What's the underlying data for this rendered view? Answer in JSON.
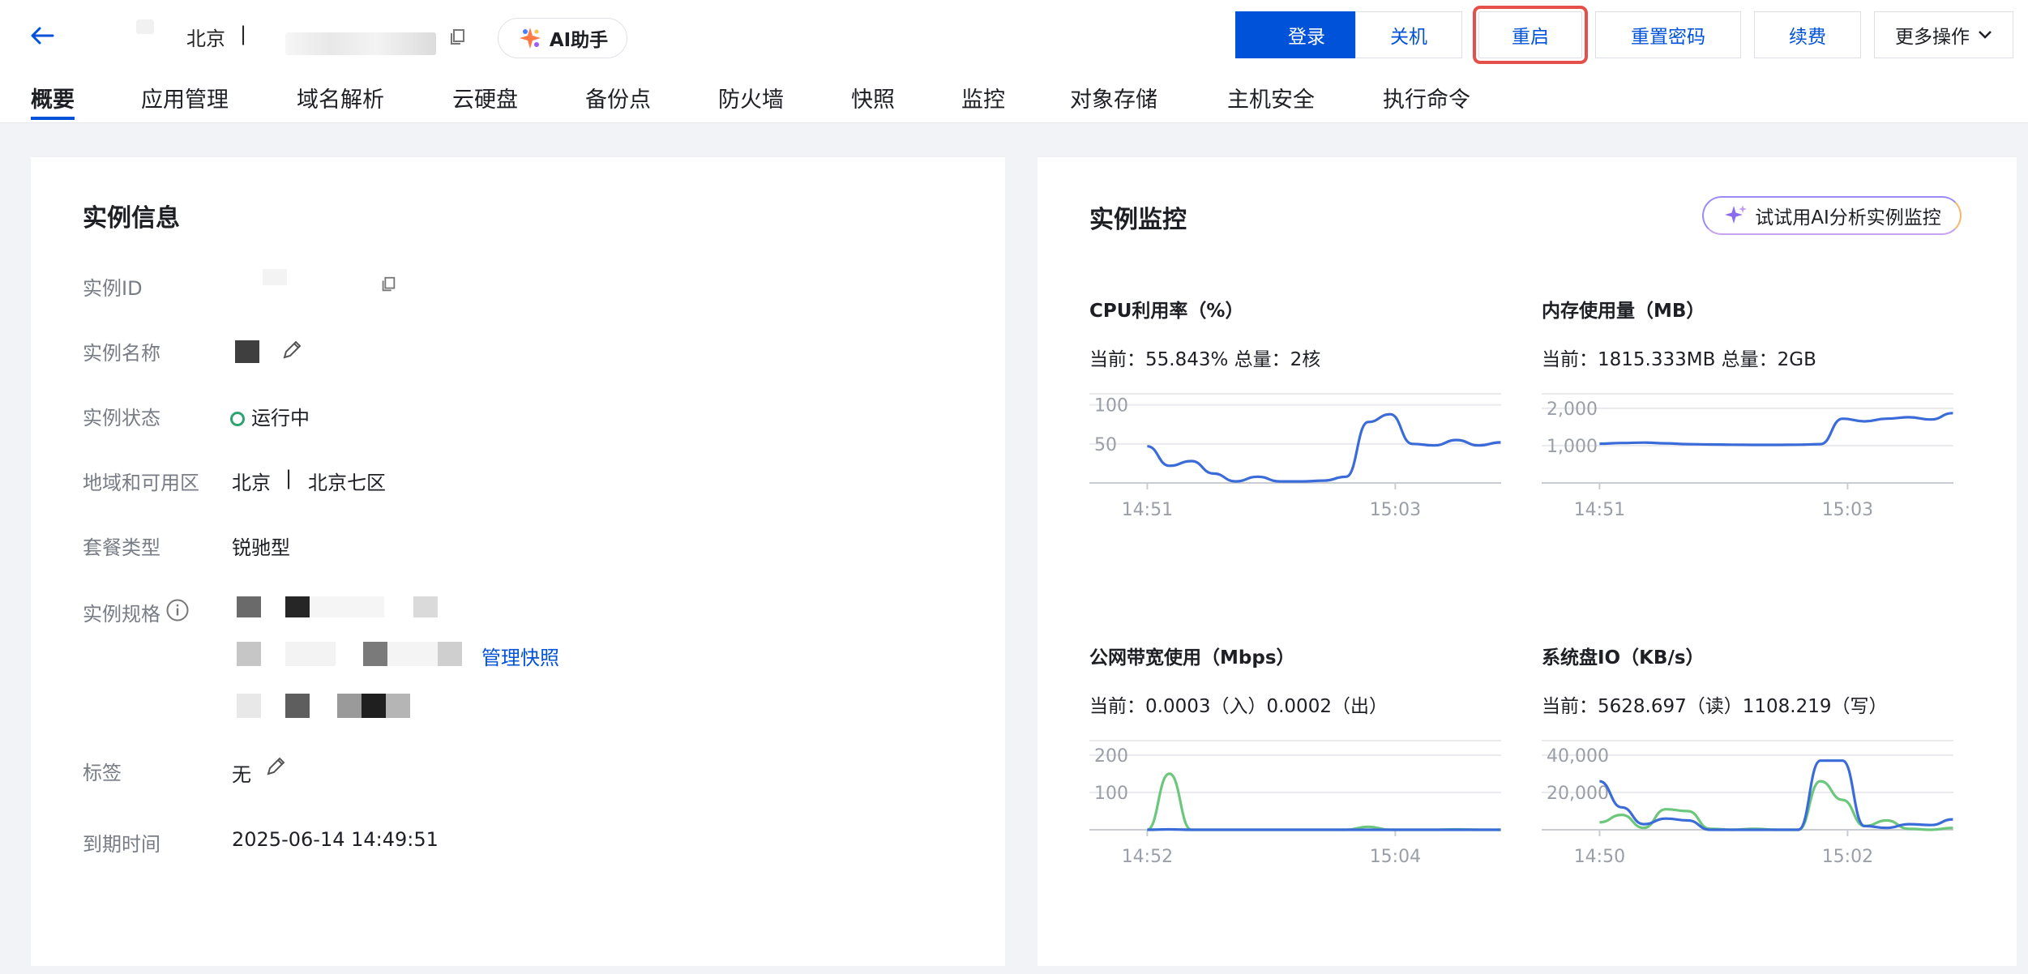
{
  "header": {
    "region": "北京",
    "region_sep": "|",
    "ai_assistant": "AI助手",
    "buttons": {
      "login": "登录",
      "shutdown": "关机",
      "restart": "重启",
      "reset_password": "重置密码",
      "renew": "续费",
      "more": "更多操作"
    }
  },
  "tabs": [
    "概要",
    "应用管理",
    "域名解析",
    "云硬盘",
    "备份点",
    "防火墙",
    "快照",
    "监控",
    "对象存储",
    "主机安全",
    "执行命令"
  ],
  "instance_info": {
    "title": "实例信息",
    "labels": {
      "id": "实例ID",
      "name": "实例名称",
      "status": "实例状态",
      "zone": "地域和可用区",
      "package": "套餐类型",
      "spec": "实例规格",
      "tags": "标签",
      "expire": "到期时间"
    },
    "values": {
      "status": "运行中",
      "zone_region": "北京",
      "zone_sep": "|",
      "zone": "北京七区",
      "package": "锐驰型",
      "manage_snapshot": "管理快照",
      "tags": "无",
      "expire": "2025-06-14 14:49:51"
    }
  },
  "monitor": {
    "title": "实例监控",
    "ai_analyze": "试试用AI分析实例监控",
    "metrics": [
      {
        "title": "CPU利用率（%）",
        "current": "当前：55.843% 总量：2核"
      },
      {
        "title": "内存使用量（MB）",
        "current": "当前：1815.333MB 总量：2GB"
      },
      {
        "title": "公网带宽使用（Mbps）",
        "current": "当前：0.0003（入）0.0002（出）"
      },
      {
        "title": "系统盘IO（KB/s）",
        "current": "当前：5628.697（读）1108.219（写）"
      }
    ]
  },
  "chart_data": [
    {
      "type": "line",
      "x_ticks": [
        "14:51",
        "15:03"
      ],
      "y_ticks": [
        "50",
        "100"
      ],
      "ylim": [
        0,
        110
      ],
      "series": [
        {
          "color": "#3a6bd9",
          "values": [
            47,
            22,
            28,
            12,
            2,
            8,
            2,
            2,
            3,
            8,
            78,
            88,
            50,
            48,
            55,
            48,
            52
          ]
        }
      ]
    },
    {
      "type": "line",
      "x_ticks": [
        "14:51",
        "15:03"
      ],
      "y_ticks": [
        "1,000",
        "2,000"
      ],
      "ylim": [
        0,
        2300
      ],
      "series": [
        {
          "color": "#3a6bd9",
          "values": [
            1050,
            1070,
            1080,
            1060,
            1040,
            1030,
            1025,
            1020,
            1020,
            1025,
            1040,
            1720,
            1650,
            1720,
            1760,
            1700,
            1870
          ]
        }
      ]
    },
    {
      "type": "line",
      "x_ticks": [
        "14:52",
        "15:04"
      ],
      "y_ticks": [
        "100",
        "200"
      ],
      "ylim": [
        0,
        230
      ],
      "series": [
        {
          "color": "#6cc77d",
          "values": [
            0,
            150,
            0,
            0,
            0,
            0,
            0,
            0,
            0,
            0,
            8,
            0,
            0,
            0,
            1,
            0,
            0
          ]
        },
        {
          "color": "#3a6bd9",
          "values": [
            0,
            1,
            0,
            0,
            0,
            0,
            0,
            0,
            0,
            0,
            0,
            0,
            0,
            0,
            0,
            0,
            0
          ]
        }
      ]
    },
    {
      "type": "line",
      "x_ticks": [
        "14:50",
        "15:02"
      ],
      "y_ticks": [
        "20,000",
        "40,000"
      ],
      "ylim": [
        0,
        46000
      ],
      "series": [
        {
          "color": "#6cc77d",
          "values": [
            4000,
            8000,
            1000,
            11000,
            10000,
            500,
            0,
            500,
            0,
            0,
            26000,
            16000,
            2000,
            5000,
            500,
            0,
            1000
          ]
        },
        {
          "color": "#3a6bd9",
          "values": [
            26000,
            12000,
            3000,
            6000,
            5000,
            0,
            0,
            0,
            0,
            0,
            37000,
            37000,
            2000,
            1000,
            3000,
            2500,
            5600
          ]
        }
      ]
    }
  ]
}
